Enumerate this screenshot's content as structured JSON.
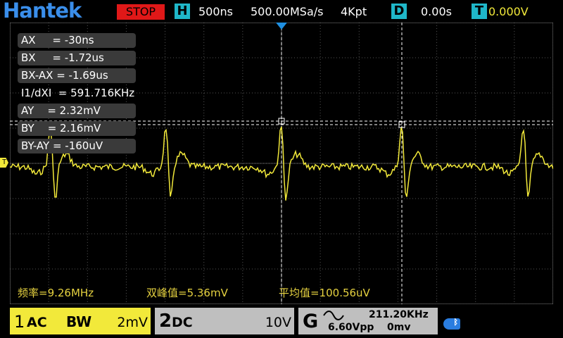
{
  "header": {
    "brand": "Hantek",
    "run_state": "STOP",
    "timebase_tag": "H",
    "timebase": "500ns",
    "sample_rate": "500.00MSa/s",
    "memory_depth": "4Kpt",
    "delay_tag": "D",
    "delay": "0.00s",
    "trigger_tag": "T",
    "trigger_level": "0.000V"
  },
  "measurements": [
    "AX     = -30ns",
    "BX     = -1.72us",
    "BX-AX = -1.69us",
    "I1/dXI  = 591.716KHz",
    "AY    = 2.32mV",
    "BY    = 2.16mV",
    "BY-AY = -160uV"
  ],
  "stats": {
    "frequency": "频率=9.26MHz",
    "peak_to_peak": "双峰值=5.36mV",
    "mean": "平均值=100.56uV"
  },
  "channel1": {
    "number": "1",
    "coupling": "AC",
    "bandwidth": "BW",
    "scale": "2mV"
  },
  "channel2": {
    "number": "2",
    "coupling": "DC",
    "scale": "10V"
  },
  "trigger": {
    "mode": "G",
    "frequency": "211.20KHz",
    "amplitude": "6.60Vpp",
    "offset": "0mv"
  },
  "markers": {
    "trigger_level_marker": "T"
  },
  "colors": {
    "brand": "#3a8eea",
    "stop": "#e01818",
    "tag": "#1fb7c9",
    "channel1": "#f2e93a",
    "panel": "#bfbfbf",
    "stats": "#e6d240"
  }
}
